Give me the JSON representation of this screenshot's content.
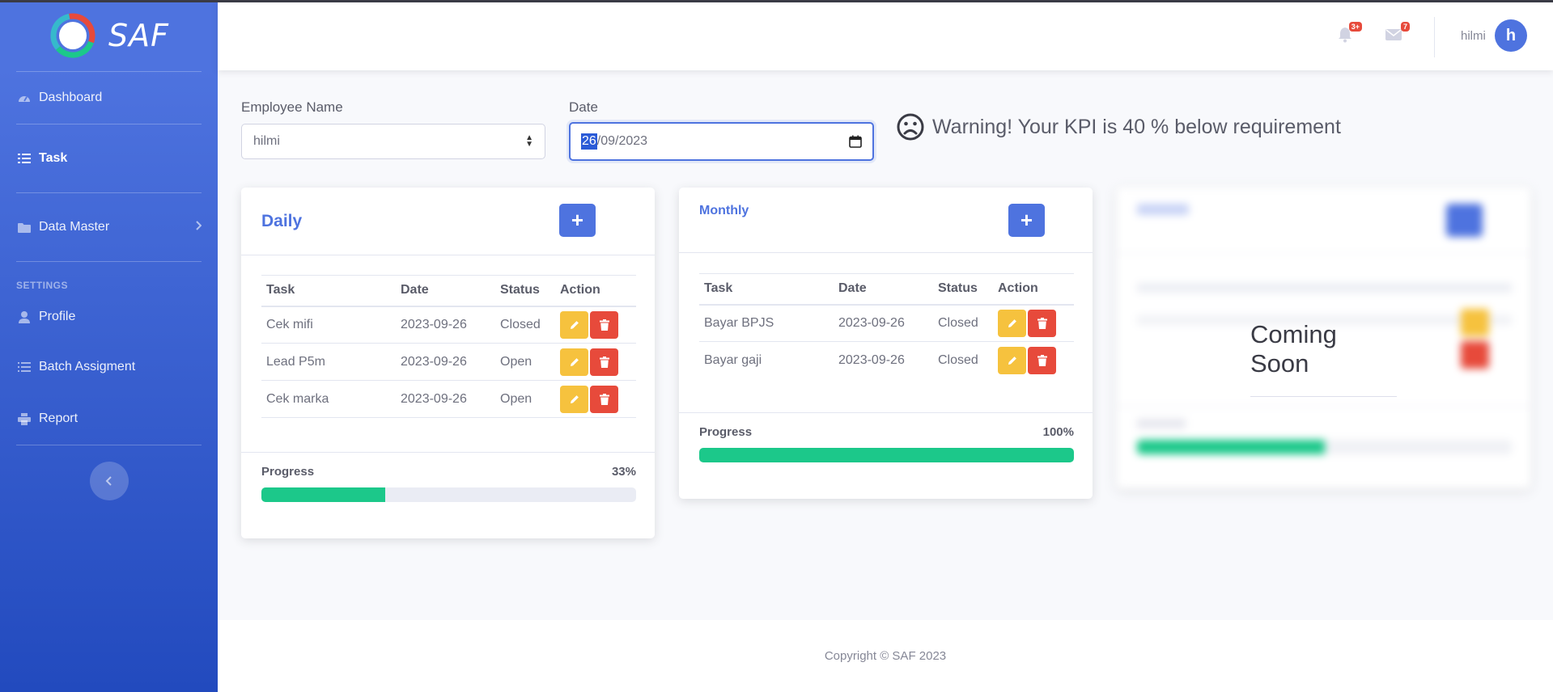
{
  "brand": {
    "name": "SAF"
  },
  "sidebar": {
    "items": [
      {
        "label": "Dashboard",
        "icon": "dashboard-icon"
      },
      {
        "label": "Task",
        "icon": "tasks-icon"
      },
      {
        "label": "Data Master",
        "icon": "folder-icon"
      }
    ],
    "settings_heading": "SETTINGS",
    "settings_items": [
      {
        "label": "Profile",
        "icon": "user-icon"
      },
      {
        "label": "Batch Assigment",
        "icon": "list-icon"
      },
      {
        "label": "Report",
        "icon": "print-icon"
      }
    ]
  },
  "topbar": {
    "alerts_badge": "3+",
    "messages_badge": "7",
    "user_name": "hilmi",
    "avatar_letter": "h"
  },
  "filters": {
    "employee_label": "Employee Name",
    "employee_value": "hilmi",
    "date_label": "Date",
    "date_day": "26",
    "date_rest": "/09/2023"
  },
  "warning": {
    "text": "Warning! Your KPI is 40 % below requirement"
  },
  "daily": {
    "title": "Daily",
    "headers": [
      "Task",
      "Date",
      "Status",
      "Action"
    ],
    "rows": [
      {
        "task": "Cek mifi",
        "date": "2023-09-26",
        "status": "Closed"
      },
      {
        "task": "Lead P5m",
        "date": "2023-09-26",
        "status": "Open"
      },
      {
        "task": "Cek marka",
        "date": "2023-09-26",
        "status": "Open"
      }
    ],
    "progress_label": "Progress",
    "progress_text": "33%",
    "progress_value": 0.33
  },
  "monthly": {
    "title": "Monthly",
    "headers": [
      "Task",
      "Date",
      "Status",
      "Action"
    ],
    "rows": [
      {
        "task": "Bayar BPJS",
        "date": "2023-09-26",
        "status": "Closed"
      },
      {
        "task": "Bayar gaji",
        "date": "2023-09-26",
        "status": "Closed"
      }
    ],
    "progress_label": "Progress",
    "progress_text": "100%",
    "progress_value": 1.0
  },
  "third_card": {
    "overlay_text": "Coming Soon",
    "progress_value": 0.5
  },
  "footer": {
    "text": "Copyright © SAF 2023"
  },
  "colors": {
    "primary": "#4e73df",
    "success": "#1cc88a",
    "warning": "#f6c23e",
    "danger": "#e74a3b"
  }
}
